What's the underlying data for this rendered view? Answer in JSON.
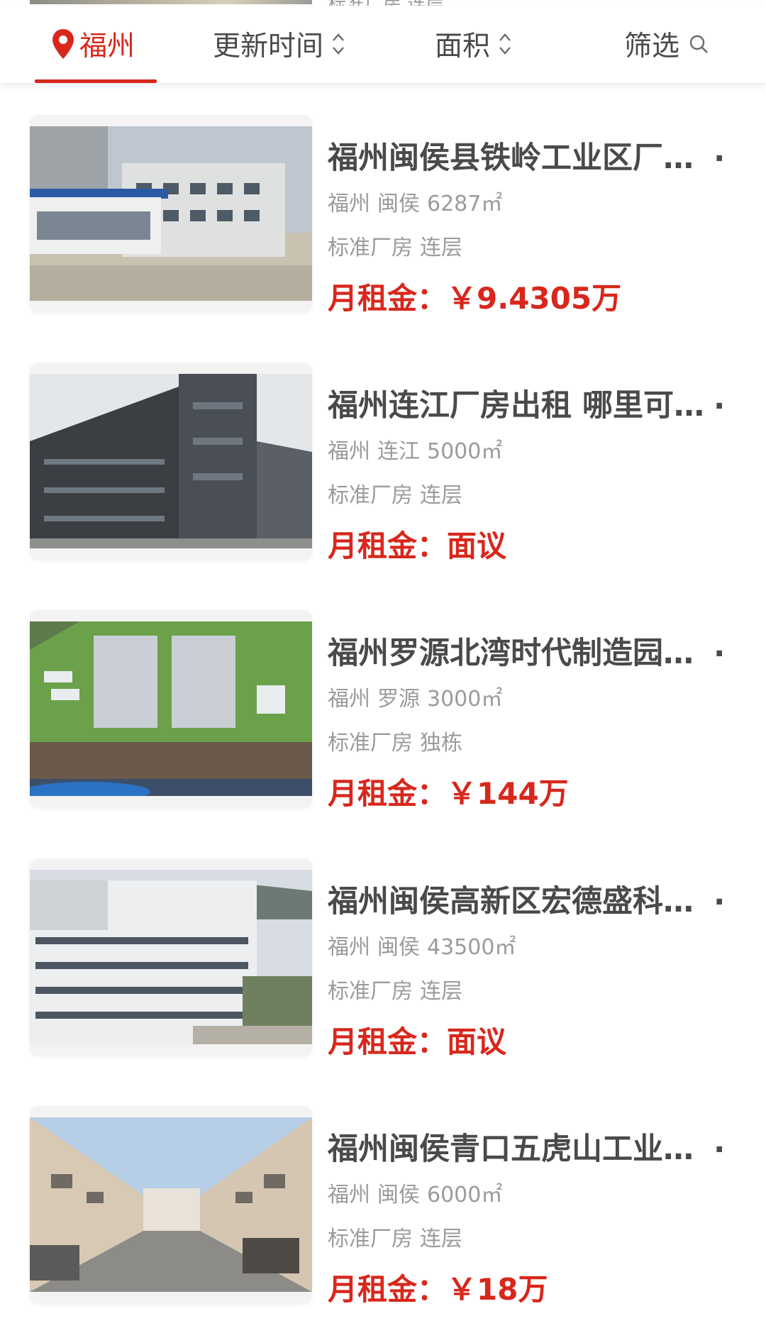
{
  "previous_item": {
    "tags": "标准厂房 连层"
  },
  "filters": {
    "city": "福州",
    "update_time": "更新时间",
    "area": "面积",
    "screen": "筛选"
  },
  "listings": [
    {
      "title": "福州闽侯县铁岭工业区厂房出租",
      "city": "福州",
      "district": "闽侯",
      "size": "6287㎡",
      "type": "标准厂房",
      "floors": "连层",
      "price_label": "月租金：",
      "price": "￥9.4305万"
    },
    {
      "title": "福州连江厂房出租 哪里可以找到",
      "city": "福州",
      "district": "连江",
      "size": "5000㎡",
      "type": "标准厂房",
      "floors": "连层",
      "price_label": "月租金：",
      "price": "面议"
    },
    {
      "title": "福州罗源北湾时代制造园厂房",
      "city": "福州",
      "district": "罗源",
      "size": "3000㎡",
      "type": "标准厂房",
      "floors": "独栋",
      "price_label": "月租金：",
      "price": "￥144万"
    },
    {
      "title": "福州闽侯高新区宏德盛科技园",
      "city": "福州",
      "district": "闽侯",
      "size": "43500㎡",
      "type": "标准厂房",
      "floors": "连层",
      "price_label": "月租金：",
      "price": "面议"
    },
    {
      "title": "福州闽侯青口五虎山工业区厂房",
      "city": "福州",
      "district": "闽侯",
      "size": "6000㎡",
      "type": "标准厂房",
      "floors": "连层",
      "price_label": "月租金：",
      "price": "￥18万"
    }
  ],
  "colors": {
    "accent": "#d8271c",
    "title": "#4a4a4a",
    "meta": "#9b9b9b"
  }
}
